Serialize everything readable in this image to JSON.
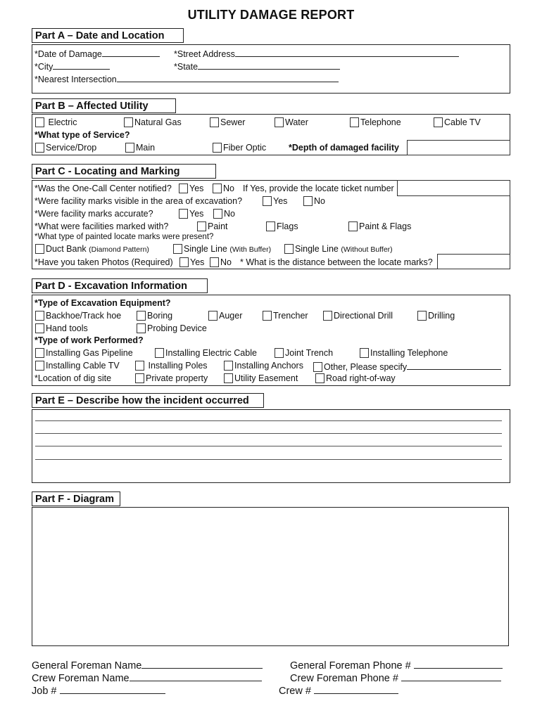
{
  "title": "UTILITY DAMAGE REPORT",
  "partA": {
    "header": "Part A – Date and Location",
    "date_of_damage": "*Date of Damage",
    "street_address": "*Street Address",
    "city": "*City",
    "state": "*State",
    "nearest_intersection": "*Nearest Intersection"
  },
  "partB": {
    "header": "Part B – Affected Utility",
    "utilities": [
      "Electric",
      "Natural Gas",
      "Sewer",
      "Water",
      "Telephone",
      "Cable TV"
    ],
    "service_question": "*What type of Service?",
    "services": [
      "Service/Drop",
      "Main",
      "Fiber Optic"
    ],
    "depth_label": "*Depth of damaged facility"
  },
  "partC": {
    "header": "Part C - Locating and Marking",
    "q_one_call": "*Was the One-Call Center notified?",
    "yes": "Yes",
    "no": "No",
    "ticket_prompt": "If Yes, provide the locate ticket number",
    "q_visible": "*Were facility marks visible in the area of excavation?",
    "q_accurate": "*Were facility marks accurate?",
    "q_marked_with": "*What were facilities marked with?",
    "marked_options": [
      "Paint",
      "Flags",
      "Paint & Flags"
    ],
    "q_painted_type": "*What type of painted locate marks were present?",
    "painted_options": [
      {
        "main": "Duct Bank ",
        "sub": "(Diamond Pattern)"
      },
      {
        "main": "Single Line ",
        "sub": "(With Buffer)"
      },
      {
        "main": "Single Line ",
        "sub": "(Without Buffer)"
      }
    ],
    "q_photos": "*Have you taken Photos (Required)",
    "q_distance": "* What is the distance between the locate marks?"
  },
  "partD": {
    "header": "Part D - Excavation Information",
    "equipment_question": "*Type of Excavation Equipment?",
    "equipment": [
      "Backhoe/Track hoe",
      "Boring",
      "Auger",
      "Trencher",
      "Directional Drill",
      "Drilling",
      "Hand tools",
      "Probing Device"
    ],
    "work_question": "*Type of work Performed?",
    "work": [
      "Installing Gas Pipeline",
      "Installing Electric Cable",
      "Joint Trench",
      "Installing Telephone",
      "Installing Cable TV",
      "Installing Poles",
      "Installing Anchors",
      "Other, Please specify"
    ],
    "location_label": "*Location of dig site",
    "locations": [
      "Private property",
      "Utility Easement",
      "Road right-of-way"
    ]
  },
  "partE": {
    "header": "Part E – Describe how the incident occurred"
  },
  "partF": {
    "header": "Part F - Diagram"
  },
  "footer": {
    "general_foreman_name": "General Foreman Name",
    "general_foreman_phone": "General Foreman Phone #",
    "crew_foreman_name": "Crew Foreman Name",
    "crew_foreman_phone": "Crew Foreman Phone #",
    "job": "Job #",
    "crew": "Crew #"
  }
}
